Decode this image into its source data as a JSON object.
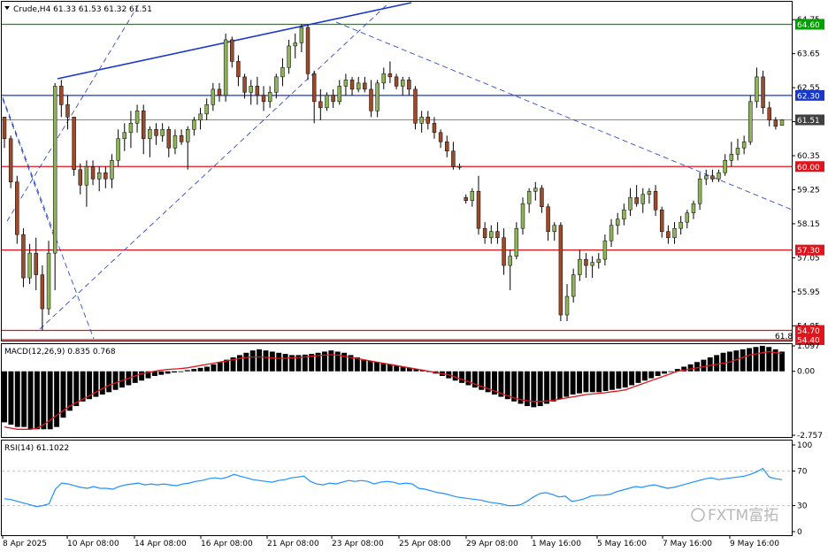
{
  "header": {
    "symbol_line": "Crude,H4  61.33 61.53 61.32 61.51",
    "macd_line": "MACD(12,26,9) 0.835 0.768",
    "rsi_line": "RSI(14) 61.1022"
  },
  "watermark": "FXTM富拓",
  "colors": {
    "bull": "#8fb35a",
    "bear": "#9b4b2a",
    "support_resistance": "#e0141c",
    "channel": "#1a38c8",
    "top_green": "#00a000",
    "macd_signal": "#e0141c",
    "rsi_line": "#1e90ff"
  },
  "chart_data": {
    "type": "candlestick",
    "symbol": "Crude",
    "timeframe": "H4",
    "price_axis": {
      "range": [
        54.4,
        65.3
      ],
      "ticks": [
        "64.75",
        "63.65",
        "62.55",
        "61.45",
        "60.35",
        "59.25",
        "58.15",
        "57.05",
        "55.95",
        "54.85"
      ]
    },
    "price_levels": [
      {
        "label": "64.60",
        "value": 64.6,
        "color": "#00a000"
      },
      {
        "label": "62.30",
        "value": 62.3,
        "color": "#1a38c8"
      },
      {
        "label": "61.51",
        "value": 61.51,
        "color": "#404040"
      },
      {
        "label": "60.00",
        "value": 60.0,
        "color": "#e0141c"
      },
      {
        "label": "57.30",
        "value": 57.3,
        "color": "#e0141c"
      },
      {
        "label": "54.70",
        "value": 54.7,
        "color": "#e0141c"
      },
      {
        "label": "54.40",
        "value": 54.4,
        "color": "#e0141c"
      }
    ],
    "fib_label": "61.8",
    "x_labels": [
      "8 Apr 2025",
      "10 Apr 08:00",
      "14 Apr 08:00",
      "16 Apr 08:00",
      "21 Apr 08:00",
      "23 Apr 08:00",
      "25 Apr 08:00",
      "29 Apr 08:00",
      "1 May 16:00",
      "5 May 16:00",
      "7 May 16:00",
      "9 May 16:00"
    ],
    "candles": [
      {
        "o": 61.6,
        "h": 61.6,
        "l": 60.6,
        "c": 60.9
      },
      {
        "o": 60.9,
        "h": 61.0,
        "l": 59.3,
        "c": 59.5
      },
      {
        "o": 59.5,
        "h": 59.7,
        "l": 57.5,
        "c": 57.8
      },
      {
        "o": 57.8,
        "h": 58.0,
        "l": 56.1,
        "c": 56.4
      },
      {
        "o": 56.4,
        "h": 57.5,
        "l": 56.2,
        "c": 57.2
      },
      {
        "o": 57.2,
        "h": 57.7,
        "l": 56.0,
        "c": 56.5
      },
      {
        "o": 56.5,
        "h": 56.8,
        "l": 54.7,
        "c": 55.4
      },
      {
        "o": 55.4,
        "h": 57.6,
        "l": 55.2,
        "c": 57.2
      },
      {
        "o": 57.2,
        "h": 62.7,
        "l": 56.0,
        "c": 62.6
      },
      {
        "o": 62.6,
        "h": 62.8,
        "l": 61.6,
        "c": 62.0
      },
      {
        "o": 62.0,
        "h": 62.3,
        "l": 61.2,
        "c": 61.6
      },
      {
        "o": 61.6,
        "h": 61.6,
        "l": 59.7,
        "c": 59.9
      },
      {
        "o": 59.9,
        "h": 60.1,
        "l": 59.1,
        "c": 59.4
      },
      {
        "o": 59.4,
        "h": 60.2,
        "l": 58.7,
        "c": 60.0
      },
      {
        "o": 60.0,
        "h": 60.2,
        "l": 59.4,
        "c": 59.6
      },
      {
        "o": 59.6,
        "h": 60.0,
        "l": 59.2,
        "c": 59.8
      },
      {
        "o": 59.8,
        "h": 60.0,
        "l": 59.3,
        "c": 59.6
      },
      {
        "o": 59.6,
        "h": 60.4,
        "l": 59.3,
        "c": 60.2
      },
      {
        "o": 60.2,
        "h": 61.2,
        "l": 60.0,
        "c": 60.9
      },
      {
        "o": 60.9,
        "h": 61.4,
        "l": 60.5,
        "c": 61.1
      },
      {
        "o": 61.1,
        "h": 61.8,
        "l": 60.6,
        "c": 61.4
      },
      {
        "o": 61.4,
        "h": 62.0,
        "l": 61.1,
        "c": 61.8
      },
      {
        "o": 61.8,
        "h": 62.0,
        "l": 60.4,
        "c": 60.9
      },
      {
        "o": 60.9,
        "h": 61.3,
        "l": 60.3,
        "c": 61.2
      },
      {
        "o": 61.2,
        "h": 61.4,
        "l": 60.7,
        "c": 61.0
      },
      {
        "o": 61.0,
        "h": 61.4,
        "l": 60.8,
        "c": 61.2
      },
      {
        "o": 61.2,
        "h": 61.3,
        "l": 60.3,
        "c": 60.6
      },
      {
        "o": 60.6,
        "h": 61.2,
        "l": 60.4,
        "c": 61.0
      },
      {
        "o": 61.0,
        "h": 61.2,
        "l": 60.7,
        "c": 60.8
      },
      {
        "o": 60.8,
        "h": 61.3,
        "l": 59.9,
        "c": 61.2
      },
      {
        "o": 61.2,
        "h": 61.6,
        "l": 61.0,
        "c": 61.5
      },
      {
        "o": 61.5,
        "h": 61.9,
        "l": 61.2,
        "c": 61.7
      },
      {
        "o": 61.7,
        "h": 62.2,
        "l": 61.5,
        "c": 62.0
      },
      {
        "o": 62.0,
        "h": 62.7,
        "l": 61.8,
        "c": 62.5
      },
      {
        "o": 62.5,
        "h": 62.7,
        "l": 62.1,
        "c": 62.3
      },
      {
        "o": 62.3,
        "h": 64.3,
        "l": 62.1,
        "c": 64.1
      },
      {
        "o": 64.1,
        "h": 64.2,
        "l": 63.2,
        "c": 63.4
      },
      {
        "o": 63.4,
        "h": 63.6,
        "l": 62.6,
        "c": 62.9
      },
      {
        "o": 62.9,
        "h": 63.0,
        "l": 62.2,
        "c": 62.4
      },
      {
        "o": 62.4,
        "h": 62.8,
        "l": 62.0,
        "c": 62.6
      },
      {
        "o": 62.6,
        "h": 62.9,
        "l": 62.0,
        "c": 62.3
      },
      {
        "o": 62.3,
        "h": 62.6,
        "l": 61.8,
        "c": 62.1
      },
      {
        "o": 62.1,
        "h": 62.6,
        "l": 61.9,
        "c": 62.4
      },
      {
        "o": 62.4,
        "h": 63.0,
        "l": 62.2,
        "c": 62.9
      },
      {
        "o": 62.9,
        "h": 63.5,
        "l": 62.6,
        "c": 63.2
      },
      {
        "o": 63.2,
        "h": 64.1,
        "l": 63.0,
        "c": 63.9
      },
      {
        "o": 63.9,
        "h": 64.3,
        "l": 63.5,
        "c": 64.0
      },
      {
        "o": 64.0,
        "h": 64.6,
        "l": 63.7,
        "c": 64.5
      },
      {
        "o": 64.5,
        "h": 64.6,
        "l": 62.8,
        "c": 63.0
      },
      {
        "o": 63.0,
        "h": 63.1,
        "l": 61.4,
        "c": 62.1
      },
      {
        "o": 62.1,
        "h": 62.5,
        "l": 61.5,
        "c": 61.9
      },
      {
        "o": 61.9,
        "h": 62.4,
        "l": 61.8,
        "c": 62.3
      },
      {
        "o": 62.3,
        "h": 62.5,
        "l": 61.9,
        "c": 62.1
      },
      {
        "o": 62.1,
        "h": 62.8,
        "l": 62.0,
        "c": 62.6
      },
      {
        "o": 62.6,
        "h": 63.0,
        "l": 62.3,
        "c": 62.8
      },
      {
        "o": 62.8,
        "h": 62.9,
        "l": 62.3,
        "c": 62.5
      },
      {
        "o": 62.5,
        "h": 62.9,
        "l": 62.4,
        "c": 62.7
      },
      {
        "o": 62.7,
        "h": 62.9,
        "l": 62.4,
        "c": 62.5
      },
      {
        "o": 62.5,
        "h": 62.8,
        "l": 61.6,
        "c": 61.8
      },
      {
        "o": 61.8,
        "h": 62.8,
        "l": 61.6,
        "c": 62.7
      },
      {
        "o": 62.7,
        "h": 63.2,
        "l": 62.5,
        "c": 63.0
      },
      {
        "o": 63.0,
        "h": 63.4,
        "l": 62.7,
        "c": 62.9
      },
      {
        "o": 62.9,
        "h": 63.0,
        "l": 62.5,
        "c": 62.6
      },
      {
        "o": 62.6,
        "h": 62.9,
        "l": 62.3,
        "c": 62.8
      },
      {
        "o": 62.8,
        "h": 62.9,
        "l": 62.3,
        "c": 62.5
      },
      {
        "o": 62.5,
        "h": 62.6,
        "l": 61.2,
        "c": 61.4
      },
      {
        "o": 61.4,
        "h": 61.8,
        "l": 61.1,
        "c": 61.6
      },
      {
        "o": 61.6,
        "h": 61.8,
        "l": 61.2,
        "c": 61.4
      },
      {
        "o": 61.4,
        "h": 61.6,
        "l": 60.9,
        "c": 61.1
      },
      {
        "o": 61.1,
        "h": 61.2,
        "l": 60.6,
        "c": 60.8
      },
      {
        "o": 60.8,
        "h": 61.0,
        "l": 60.3,
        "c": 60.5
      },
      {
        "o": 60.5,
        "h": 60.8,
        "l": 59.9,
        "c": 60.0
      },
      {
        "o": 60.0,
        "h": 60.1,
        "l": 59.9,
        "c": 60.0
      },
      {
        "o": 59.0,
        "h": 59.1,
        "l": 58.8,
        "c": 58.9
      },
      {
        "o": 58.9,
        "h": 59.3,
        "l": 58.7,
        "c": 59.2
      },
      {
        "o": 59.2,
        "h": 59.7,
        "l": 57.8,
        "c": 58.0
      },
      {
        "o": 58.0,
        "h": 58.2,
        "l": 57.5,
        "c": 57.7
      },
      {
        "o": 57.7,
        "h": 58.1,
        "l": 57.5,
        "c": 57.9
      },
      {
        "o": 57.9,
        "h": 58.2,
        "l": 57.5,
        "c": 57.7
      },
      {
        "o": 57.7,
        "h": 58.0,
        "l": 56.5,
        "c": 56.8
      },
      {
        "o": 56.8,
        "h": 57.3,
        "l": 56.0,
        "c": 57.1
      },
      {
        "o": 57.1,
        "h": 58.2,
        "l": 57.0,
        "c": 58.0
      },
      {
        "o": 58.0,
        "h": 59.0,
        "l": 57.8,
        "c": 58.8
      },
      {
        "o": 58.8,
        "h": 59.3,
        "l": 58.5,
        "c": 59.2
      },
      {
        "o": 59.2,
        "h": 59.5,
        "l": 58.9,
        "c": 59.3
      },
      {
        "o": 59.3,
        "h": 59.4,
        "l": 58.5,
        "c": 58.7
      },
      {
        "o": 58.7,
        "h": 58.8,
        "l": 57.6,
        "c": 57.9
      },
      {
        "o": 57.9,
        "h": 58.2,
        "l": 57.6,
        "c": 58.1
      },
      {
        "o": 58.1,
        "h": 58.2,
        "l": 55.0,
        "c": 55.2
      },
      {
        "o": 55.2,
        "h": 56.2,
        "l": 55.0,
        "c": 55.8
      },
      {
        "o": 55.8,
        "h": 56.7,
        "l": 55.6,
        "c": 56.5
      },
      {
        "o": 56.5,
        "h": 57.3,
        "l": 56.3,
        "c": 57.0
      },
      {
        "o": 57.0,
        "h": 57.2,
        "l": 56.4,
        "c": 56.8
      },
      {
        "o": 56.8,
        "h": 57.1,
        "l": 56.4,
        "c": 56.9
      },
      {
        "o": 56.9,
        "h": 57.2,
        "l": 56.7,
        "c": 57.0
      },
      {
        "o": 57.0,
        "h": 57.8,
        "l": 56.8,
        "c": 57.6
      },
      {
        "o": 57.6,
        "h": 58.3,
        "l": 57.4,
        "c": 58.1
      },
      {
        "o": 58.1,
        "h": 58.5,
        "l": 57.8,
        "c": 58.3
      },
      {
        "o": 58.3,
        "h": 58.8,
        "l": 58.1,
        "c": 58.6
      },
      {
        "o": 58.6,
        "h": 59.3,
        "l": 58.4,
        "c": 59.0
      },
      {
        "o": 59.0,
        "h": 59.4,
        "l": 58.7,
        "c": 58.8
      },
      {
        "o": 58.8,
        "h": 59.3,
        "l": 58.5,
        "c": 59.1
      },
      {
        "o": 59.1,
        "h": 59.3,
        "l": 58.8,
        "c": 59.2
      },
      {
        "o": 59.2,
        "h": 59.4,
        "l": 58.4,
        "c": 58.6
      },
      {
        "o": 58.6,
        "h": 58.7,
        "l": 57.7,
        "c": 57.9
      },
      {
        "o": 57.9,
        "h": 58.1,
        "l": 57.5,
        "c": 57.7
      },
      {
        "o": 57.7,
        "h": 58.2,
        "l": 57.5,
        "c": 58.0
      },
      {
        "o": 58.0,
        "h": 58.4,
        "l": 57.8,
        "c": 58.2
      },
      {
        "o": 58.2,
        "h": 58.6,
        "l": 58.0,
        "c": 58.5
      },
      {
        "o": 58.5,
        "h": 58.9,
        "l": 58.3,
        "c": 58.8
      },
      {
        "o": 58.8,
        "h": 59.8,
        "l": 58.6,
        "c": 59.6
      },
      {
        "o": 59.6,
        "h": 59.9,
        "l": 59.4,
        "c": 59.7
      },
      {
        "o": 59.7,
        "h": 59.9,
        "l": 59.5,
        "c": 59.6
      },
      {
        "o": 59.6,
        "h": 59.9,
        "l": 59.5,
        "c": 59.8
      },
      {
        "o": 59.8,
        "h": 60.4,
        "l": 59.7,
        "c": 60.2
      },
      {
        "o": 60.2,
        "h": 60.8,
        "l": 60.0,
        "c": 60.4
      },
      {
        "o": 60.4,
        "h": 60.9,
        "l": 60.2,
        "c": 60.6
      },
      {
        "o": 60.6,
        "h": 61.0,
        "l": 60.4,
        "c": 60.8
      },
      {
        "o": 60.8,
        "h": 62.3,
        "l": 60.7,
        "c": 62.1
      },
      {
        "o": 62.1,
        "h": 63.2,
        "l": 61.9,
        "c": 62.9
      },
      {
        "o": 62.9,
        "h": 63.1,
        "l": 61.7,
        "c": 61.9
      },
      {
        "o": 61.9,
        "h": 62.1,
        "l": 61.3,
        "c": 61.5
      },
      {
        "o": 61.5,
        "h": 61.6,
        "l": 61.2,
        "c": 61.3
      },
      {
        "o": 61.33,
        "h": 61.53,
        "l": 61.32,
        "c": 61.51
      }
    ],
    "macd": {
      "axis_labels": [
        "1.097",
        "0.00",
        "-2.757"
      ],
      "range": [
        -2.757,
        1.097
      ],
      "histogram": [
        -2.2,
        -2.3,
        -2.4,
        -2.4,
        -2.5,
        -2.5,
        -2.5,
        -2.5,
        -2.4,
        -2.0,
        -1.7,
        -1.5,
        -1.3,
        -1.2,
        -1.1,
        -1.0,
        -0.9,
        -0.8,
        -0.7,
        -0.6,
        -0.5,
        -0.4,
        -0.3,
        -0.2,
        -0.15,
        -0.1,
        -0.05,
        0.0,
        0.05,
        0.1,
        0.15,
        0.2,
        0.3,
        0.4,
        0.5,
        0.6,
        0.7,
        0.8,
        0.9,
        0.95,
        0.9,
        0.85,
        0.8,
        0.75,
        0.7,
        0.7,
        0.72,
        0.75,
        0.8,
        0.85,
        0.9,
        0.85,
        0.8,
        0.7,
        0.6,
        0.5,
        0.45,
        0.4,
        0.35,
        0.3,
        0.25,
        0.2,
        0.15,
        0.1,
        0.05,
        0.0,
        -0.1,
        -0.2,
        -0.3,
        -0.4,
        -0.5,
        -0.6,
        -0.7,
        -0.8,
        -0.9,
        -1.0,
        -1.1,
        -1.2,
        -1.3,
        -1.4,
        -1.5,
        -1.55,
        -1.5,
        -1.4,
        -1.3,
        -1.2,
        -1.1,
        -1.0,
        -0.95,
        -0.9,
        -0.9,
        -0.9,
        -0.85,
        -0.8,
        -0.75,
        -0.7,
        -0.6,
        -0.5,
        -0.4,
        -0.3,
        -0.2,
        -0.1,
        0.0,
        0.1,
        0.2,
        0.3,
        0.4,
        0.5,
        0.6,
        0.7,
        0.8,
        0.85,
        0.9,
        0.95,
        1.0,
        1.05,
        1.1,
        1.05,
        0.95,
        0.85
      ],
      "signal": [
        -2.4,
        -2.45,
        -2.5,
        -2.5,
        -2.5,
        -2.45,
        -2.3,
        -2.1,
        -1.9,
        -1.7,
        -1.5,
        -1.35,
        -1.2,
        -1.05,
        -0.9,
        -0.75,
        -0.6,
        -0.5,
        -0.4,
        -0.3,
        -0.2,
        -0.1,
        -0.05,
        0.0,
        0.05,
        0.08,
        0.1,
        0.12,
        0.15,
        0.2,
        0.25,
        0.3,
        0.35,
        0.4,
        0.45,
        0.5,
        0.55,
        0.6,
        0.62,
        0.62,
        0.6,
        0.58,
        0.56,
        0.56,
        0.58,
        0.6,
        0.62,
        0.65,
        0.68,
        0.7,
        0.72,
        0.7,
        0.65,
        0.6,
        0.55,
        0.5,
        0.45,
        0.4,
        0.35,
        0.3,
        0.25,
        0.2,
        0.15,
        0.1,
        0.05,
        0.0,
        -0.05,
        -0.1,
        -0.15,
        -0.25,
        -0.35,
        -0.45,
        -0.55,
        -0.65,
        -0.75,
        -0.85,
        -0.95,
        -1.05,
        -1.15,
        -1.22,
        -1.27,
        -1.3,
        -1.3,
        -1.28,
        -1.25,
        -1.2,
        -1.15,
        -1.1,
        -1.05,
        -1.0,
        -0.98,
        -0.95,
        -0.92,
        -0.88,
        -0.85,
        -0.8,
        -0.7,
        -0.6,
        -0.5,
        -0.4,
        -0.3,
        -0.2,
        -0.1,
        0.0,
        0.05,
        0.1,
        0.15,
        0.2,
        0.25,
        0.3,
        0.35,
        0.4,
        0.5,
        0.6,
        0.7,
        0.75,
        0.8,
        0.85,
        0.8,
        0.77
      ]
    },
    "rsi": {
      "axis_labels": [
        "100",
        "70",
        "30",
        "0"
      ],
      "range": [
        0,
        100
      ],
      "levels": [
        70,
        30
      ],
      "values": [
        38,
        37,
        35,
        33,
        31,
        29,
        30,
        32,
        49,
        56,
        55,
        53,
        51,
        50,
        52,
        50,
        50,
        49,
        52,
        54,
        55,
        56,
        54,
        55,
        54,
        55,
        54,
        53,
        55,
        56,
        58,
        59,
        61,
        62,
        61,
        63,
        66,
        64,
        62,
        60,
        59,
        58,
        57,
        59,
        60,
        62,
        63,
        64,
        58,
        55,
        54,
        56,
        55,
        57,
        59,
        58,
        59,
        58,
        55,
        57,
        58,
        57,
        55,
        56,
        55,
        50,
        49,
        47,
        45,
        44,
        42,
        40,
        39,
        38,
        37,
        36,
        34,
        33,
        32,
        30,
        30,
        31,
        35,
        40,
        44,
        45,
        43,
        40,
        41,
        35,
        36,
        38,
        41,
        42,
        42,
        43,
        46,
        48,
        50,
        52,
        51,
        53,
        54,
        52,
        50,
        51,
        53,
        55,
        57,
        59,
        61,
        62,
        60,
        61,
        62,
        63,
        64,
        66,
        69,
        73,
        63,
        61,
        60
      ]
    }
  }
}
